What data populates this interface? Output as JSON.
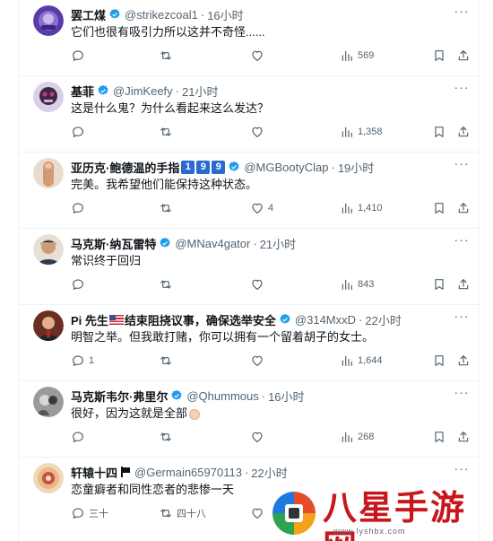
{
  "tweets": [
    {
      "name": "罢工煤",
      "handle": "@strikezcoal1",
      "time": "16小时",
      "text": "它们也很有吸引力所以这并不奇怪......",
      "likes": "",
      "views": "569",
      "reply_count": "",
      "repost_count": ""
    },
    {
      "name": "基菲",
      "handle": "@JimKeefy",
      "time": "21小时",
      "text": "这是什么鬼？为什么看起来这么发达？",
      "likes": "",
      "views": "1,358",
      "reply_count": "",
      "repost_count": ""
    },
    {
      "name": "亚历克·鲍德温的手指",
      "name_suffix": [
        "1",
        "9",
        "9"
      ],
      "handle": "@MGBootyClap",
      "time": "19小时",
      "text": "完美。我希望他们能保持这种状态。",
      "likes": "4",
      "views": "1,410",
      "reply_count": "",
      "repost_count": ""
    },
    {
      "name": "马克斯·纳瓦雷特",
      "handle": "@MNav4gator",
      "time": "21小时",
      "text": "常识终于回归",
      "likes": "",
      "views": "843",
      "reply_count": "",
      "repost_count": ""
    },
    {
      "name_a": "Pi 先生",
      "name_b": "结束阻挠议事，确保选举安全",
      "handle": "@314MxxD",
      "time": "22小时",
      "text": "明智之举。但我敢打赌，你可以拥有一个留着胡子的女士。",
      "likes": "",
      "views": "1,644",
      "reply_count": "1",
      "repost_count": ""
    },
    {
      "name": "马克斯韦尔·弗里尔",
      "handle": "@Qhummous",
      "time": "16小时",
      "text": "很好，因为这就是全部",
      "likes": "",
      "views": "268",
      "reply_count": "",
      "repost_count": ""
    },
    {
      "name": "轩辕十四",
      "handle": "@Germain65970113",
      "time": "22小时",
      "text": "恋童癖者和同性恋者的悲惨一天",
      "likes": "",
      "views": "",
      "reply_count": "三十",
      "repost_count": "四十八"
    }
  ],
  "separator": "·",
  "more_glyph": "···",
  "watermark": {
    "title": "八星手游网",
    "url": "www.lyshbx.com"
  },
  "colors": {
    "text": "#0f1419",
    "muted": "#536471",
    "verified": "#1d9bf0",
    "border": "#eff3f4",
    "watermark": "#c8161d"
  }
}
